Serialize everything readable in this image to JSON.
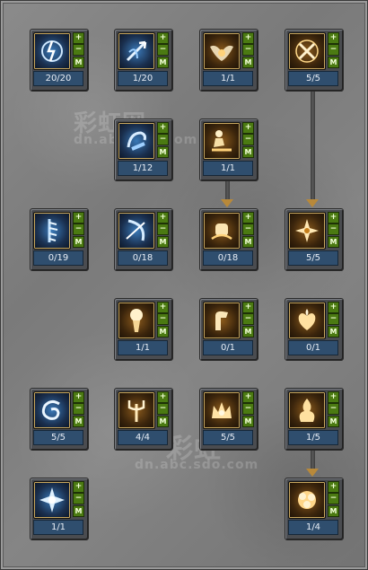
{
  "controls": {
    "plus": "+",
    "minus": "−",
    "max": "M"
  },
  "watermark": {
    "line1": "彩虹网",
    "line2": "dn.abc.sdo.com",
    "line3": "彩虹",
    "line4": "dn.abc.sdo.com"
  },
  "skills": [
    {
      "id": "r1c1",
      "count": "20/20",
      "icon": "lightning-rune-icon",
      "color": "blue"
    },
    {
      "id": "r1c2",
      "count": "1/20",
      "icon": "arrow-shot-icon",
      "color": "blue"
    },
    {
      "id": "r1c3",
      "count": "1/1",
      "icon": "winged-burst-icon",
      "color": "gold"
    },
    {
      "id": "r1c4",
      "count": "5/5",
      "icon": "cross-slash-icon",
      "color": "gold"
    },
    {
      "id": "r2c2",
      "count": "1/12",
      "icon": "spin-kick-icon",
      "color": "blue"
    },
    {
      "id": "r2c3",
      "count": "1/1",
      "icon": "crouch-strike-icon",
      "color": "gold"
    },
    {
      "id": "r3c1",
      "count": "0/19",
      "icon": "chain-spine-icon",
      "color": "blue"
    },
    {
      "id": "r3c2",
      "count": "0/18",
      "icon": "bow-draw-icon",
      "color": "blue"
    },
    {
      "id": "r3c3",
      "count": "0/18",
      "icon": "fist-burst-icon",
      "color": "gold"
    },
    {
      "id": "r3c4",
      "count": "5/5",
      "icon": "blade-star-icon",
      "color": "gold"
    },
    {
      "id": "r4c2",
      "count": "1/1",
      "icon": "glowing-fist-icon",
      "color": "gold"
    },
    {
      "id": "r4c3",
      "count": "0/1",
      "icon": "bent-arm-icon",
      "color": "gold"
    },
    {
      "id": "r4c4",
      "count": "0/1",
      "icon": "heart-flame-icon",
      "color": "gold"
    },
    {
      "id": "r5c1",
      "count": "5/5",
      "icon": "swirl-orb-icon",
      "color": "blue"
    },
    {
      "id": "r5c2",
      "count": "4/4",
      "icon": "trident-icon",
      "color": "gold"
    },
    {
      "id": "r5c3",
      "count": "5/5",
      "icon": "fire-crown-icon",
      "color": "gold"
    },
    {
      "id": "r5c4",
      "count": "1/5",
      "icon": "fire-pillar-icon",
      "color": "gold"
    },
    {
      "id": "r6c1",
      "count": "1/1",
      "icon": "crystal-burst-icon",
      "color": "blue"
    },
    {
      "id": "r6c4",
      "count": "1/4",
      "icon": "explosion-icon",
      "color": "gold"
    }
  ]
}
